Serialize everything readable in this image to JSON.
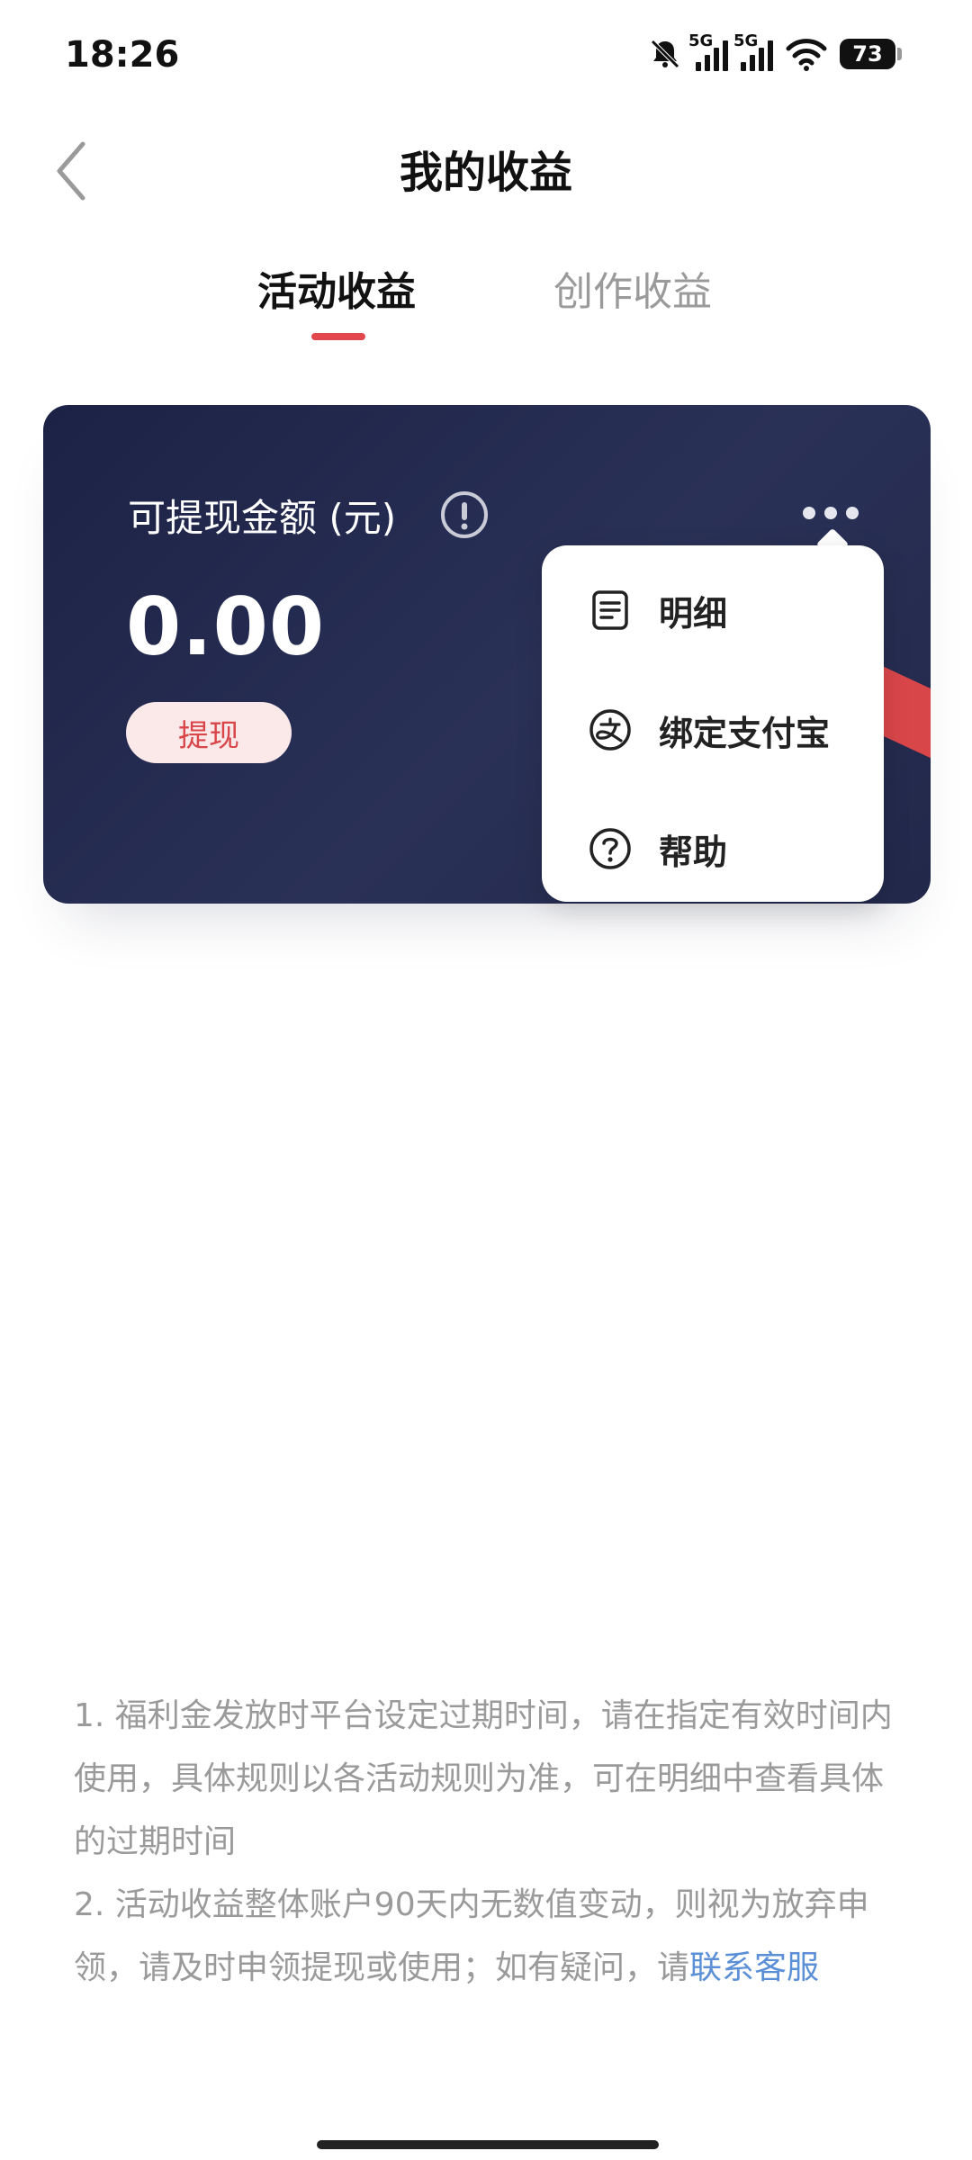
{
  "status_bar": {
    "time": "18:26",
    "network_label_1": "5G",
    "network_label_2": "5G",
    "battery": "73",
    "icons": [
      "mute-bell-icon",
      "signal-icon",
      "signal-icon",
      "wifi-icon",
      "battery-icon"
    ]
  },
  "header": {
    "title": "我的收益",
    "back_icon": "chevron-left-icon"
  },
  "tabs": [
    {
      "label": "活动收益",
      "active": true
    },
    {
      "label": "创作收益",
      "active": false
    }
  ],
  "card": {
    "label": "可提现金额 (元)",
    "info_icon": "exclamation-circle-icon",
    "amount": "0.00",
    "withdraw_label": "提现",
    "more_icon": "more-dots-icon"
  },
  "menu": {
    "items": [
      {
        "label": "明细",
        "icon": "document-list-icon"
      },
      {
        "label": "绑定支付宝",
        "icon": "alipay-icon"
      },
      {
        "label": "帮助",
        "icon": "help-circle-icon"
      }
    ]
  },
  "notes": {
    "line1": "1. 福利金发放时平台设定过期时间，请在指定有效时间内使用，具体规则以各活动规则为准，可在明细中查看具体的过期时间",
    "line2_prefix": "2. 活动收益整体账户90天内无数值变动，则视为放弃申领，请及时申领提现或使用；如有疑问，请",
    "line2_link": "联系客服"
  },
  "colors": {
    "accent": "#e2474e",
    "card_bg": "#22284a",
    "link": "#5b8fd6",
    "muted_text": "#9a9a9a"
  }
}
